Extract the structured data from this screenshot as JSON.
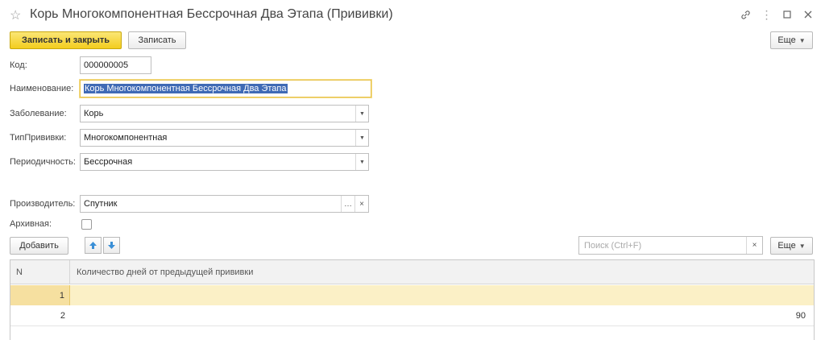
{
  "window": {
    "title": "Корь Многокомпонентная Бессрочная Два Этапа (Прививки)"
  },
  "toolbar": {
    "save_close_label": "Записать и закрыть",
    "save_label": "Записать",
    "more_label": "Еще"
  },
  "form": {
    "code_label": "Код:",
    "code_value": "000000005",
    "name_label": "Наименование:",
    "name_value": "Корь Многокомпонентная Бессрочная Два Этапа",
    "disease_label": "Заболевание:",
    "disease_value": "Корь",
    "type_label": "ТипПрививки:",
    "type_value": "Многокомпонентная",
    "period_label": "Периодичность:",
    "period_value": "Бессрочная",
    "producer_label": "Производитель:",
    "producer_value": "Спутник",
    "archive_label": "Архивная:",
    "archive_checked": false
  },
  "table_toolbar": {
    "add_label": "Добавить",
    "search_placeholder": "Поиск (Ctrl+F)",
    "more_label": "Еще"
  },
  "table": {
    "columns": [
      "N",
      "Количество дней от предыдущей прививки"
    ],
    "rows": [
      {
        "n": "1",
        "days": ""
      },
      {
        "n": "2",
        "days": "90"
      }
    ],
    "selected_row": 0
  },
  "colors": {
    "primary_button": "#f3cd1e",
    "selection": "#fbf0c6",
    "text_selection": "#3f6ab5"
  }
}
